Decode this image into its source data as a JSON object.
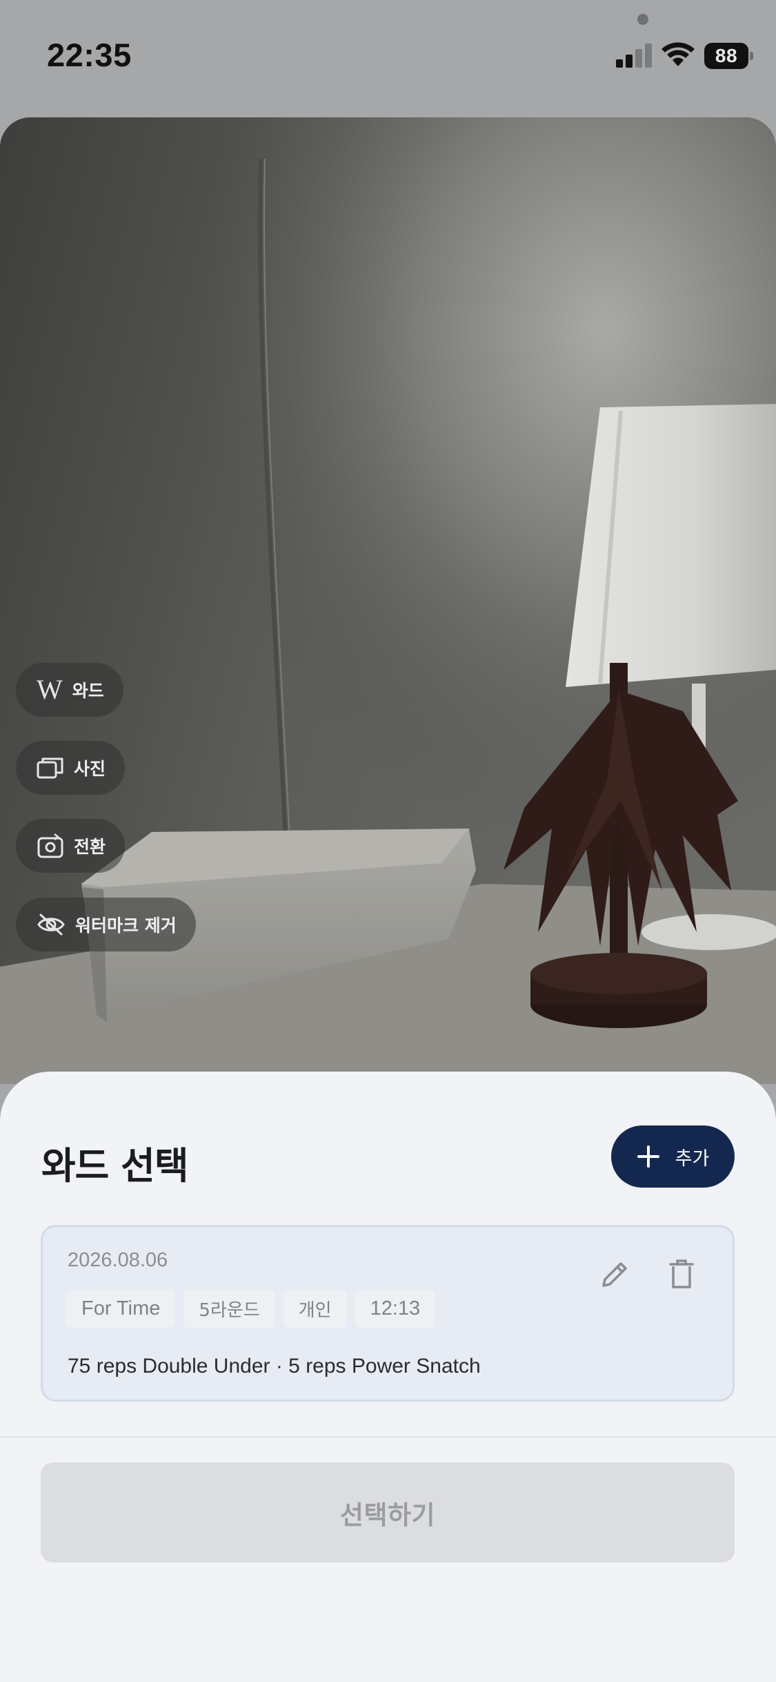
{
  "status_bar": {
    "time": "22:35",
    "battery": "88"
  },
  "camera_tools": [
    {
      "icon": "w-icon",
      "glyph": "W",
      "label": "와드"
    },
    {
      "icon": "photo-stack-icon",
      "label": "사진"
    },
    {
      "icon": "switch-camera-icon",
      "label": "전환"
    },
    {
      "icon": "eye-off-icon",
      "label": "워터마크 제거"
    }
  ],
  "sheet": {
    "title": "와드 선택",
    "add_label": "추가",
    "wod": {
      "date": "2026.08.06",
      "tags": [
        "For Time",
        "5라운드",
        "개인",
        "12:13"
      ],
      "description": "75 reps Double Under · 5 reps Power Snatch"
    },
    "select_label": "선택하기"
  },
  "colors": {
    "accent": "#14284f",
    "sheet_bg": "#f2f3f7",
    "card_bg": "#e7ebf3",
    "disabled_button": "#dcdde1"
  }
}
